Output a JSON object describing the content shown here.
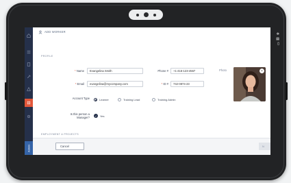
{
  "header": {
    "title": "ADD WORKER"
  },
  "profile": {
    "section_label": "PROFILE",
    "name_label": "Name",
    "name_value": "Evangelina Smith",
    "email_label": "Email",
    "email_value": "evangelina@mycompany.com",
    "phone_label": "Phone #",
    "phone_value": "+1-416-123-4567",
    "id_label": "ID #",
    "id_value": "742-0874-23",
    "photo_label": "Photo",
    "account_type_label": "Account Type",
    "account_types": [
      "Learner",
      "Training Lead",
      "Training Admin"
    ],
    "account_type_selected": "Learner",
    "manager_label": "Is this person a Manager?",
    "manager_value": "Yes"
  },
  "employment": {
    "section_label": "EMPLOYMENT & PROJECTS"
  },
  "footer": {
    "cancel_label": "Cancel",
    "next_label": "N"
  },
  "sidebar": {
    "icons": [
      "home-icon",
      "list-icon",
      "document-icon",
      "wrench-icon",
      "warning-icon",
      "worker-icon",
      "settings-icon"
    ],
    "active": "worker-icon",
    "user_label": "Admin"
  },
  "colors": {
    "nav_bg": "#25304a",
    "accent": "#e2573a",
    "user_tab": "#3564a8"
  }
}
